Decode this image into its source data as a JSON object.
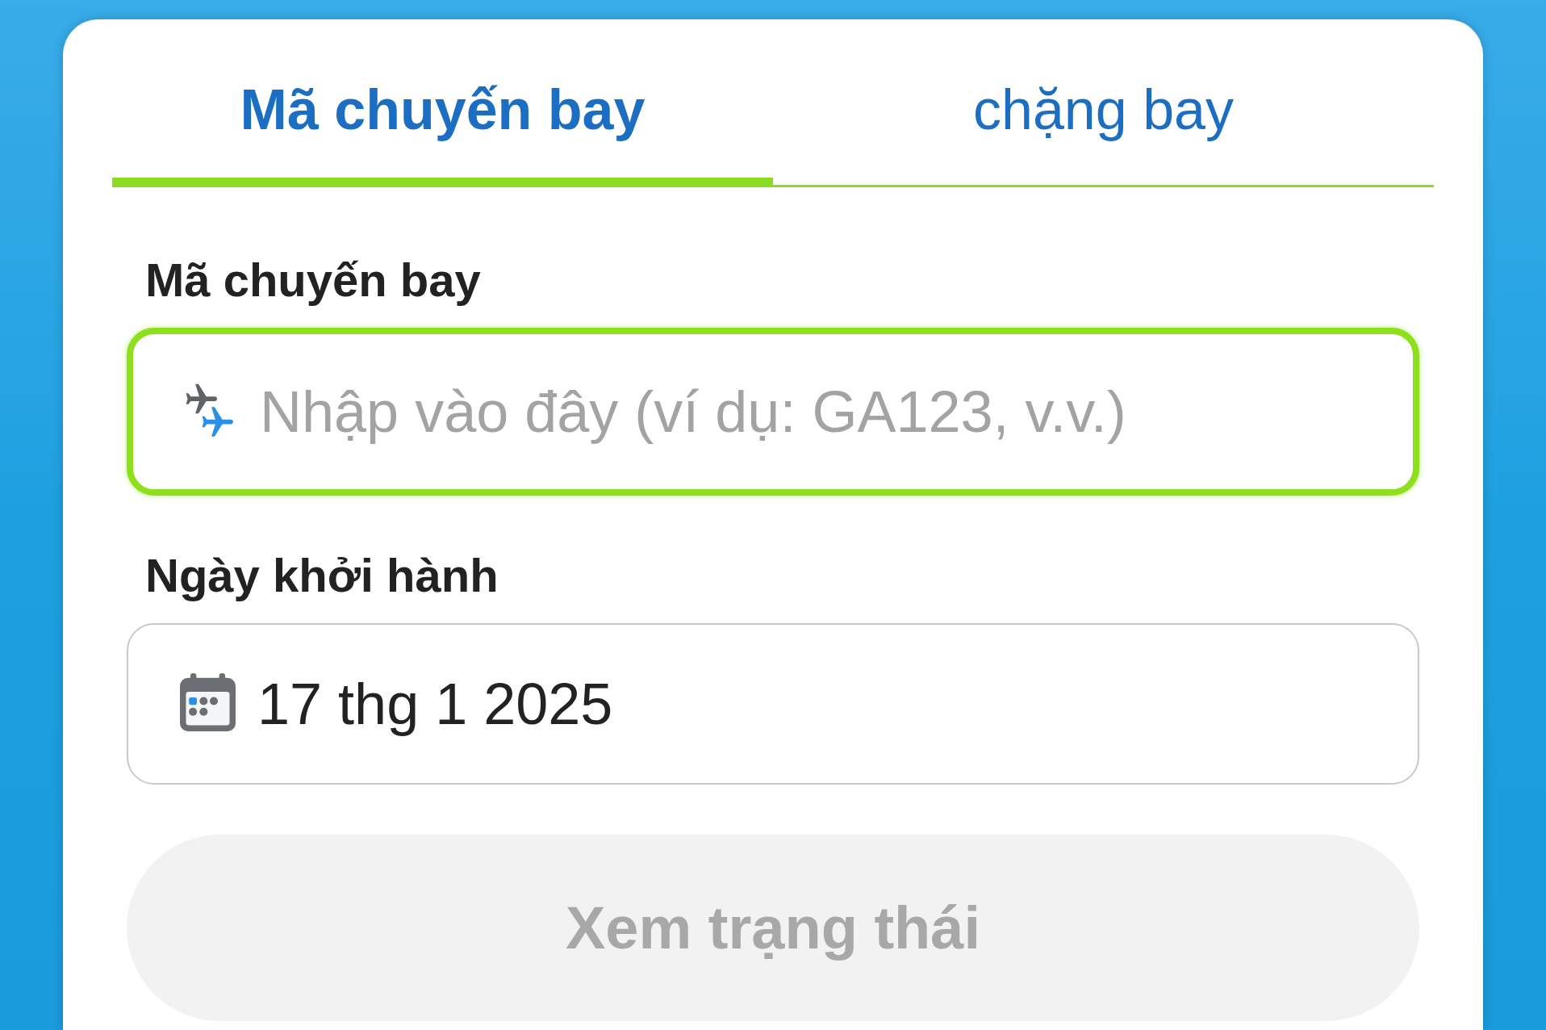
{
  "tabs": [
    {
      "label": "Mã chuyến bay",
      "selected": true
    },
    {
      "label": "chặng bay",
      "selected": false
    }
  ],
  "form": {
    "fields": [
      {
        "kind": "text",
        "label": "Mã chuyến bay",
        "placeholder": "Nhập vào đây (ví dụ: GA123, v.v.)",
        "focused": true
      },
      {
        "kind": "date",
        "label": "Ngày khởi hành",
        "value": "17 thg 1 2025",
        "focused": false
      }
    ],
    "submit": {
      "label": "Xem trạng thái",
      "disabled": true
    }
  }
}
